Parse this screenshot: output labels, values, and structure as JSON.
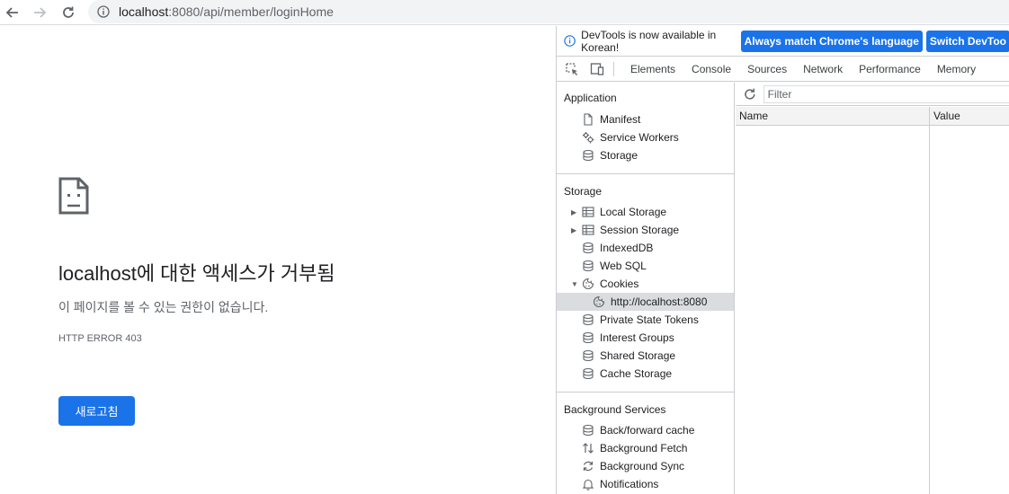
{
  "toolbar": {
    "back_icon": "back-arrow-icon",
    "forward_icon": "forward-arrow-icon",
    "reload_icon": "reload-icon",
    "url_host": "localhost",
    "url_rest": ":8080/api/member/loginHome"
  },
  "error_page": {
    "title": "localhost에 대한 액세스가 거부됨",
    "subtitle": "이 페이지를 볼 수 있는 권한이 없습니다.",
    "error_code": "HTTP ERROR 403",
    "reload_label": "새로고침",
    "accent": "#1a73e8"
  },
  "devtools": {
    "banner": {
      "message": "DevTools is now available in Korean!",
      "match_button": "Always match Chrome's language",
      "switch_button": "Switch DevToo"
    },
    "tabs": [
      "Elements",
      "Console",
      "Sources",
      "Network",
      "Performance",
      "Memory"
    ],
    "sidebar": {
      "application_title": "Application",
      "application_items": [
        {
          "label": "Manifest",
          "icon": "document-icon"
        },
        {
          "label": "Service Workers",
          "icon": "gears-icon"
        },
        {
          "label": "Storage",
          "icon": "database-icon"
        }
      ],
      "storage_title": "Storage",
      "storage_items": [
        {
          "label": "Local Storage",
          "icon": "table-icon",
          "expand": "collapsed"
        },
        {
          "label": "Session Storage",
          "icon": "table-icon",
          "expand": "collapsed"
        },
        {
          "label": "IndexedDB",
          "icon": "database-icon"
        },
        {
          "label": "Web SQL",
          "icon": "database-icon"
        },
        {
          "label": "Cookies",
          "icon": "cookie-icon",
          "expand": "expanded"
        },
        {
          "label": "http://localhost:8080",
          "icon": "cookie-icon",
          "selected": true
        },
        {
          "label": "Private State Tokens",
          "icon": "database-icon"
        },
        {
          "label": "Interest Groups",
          "icon": "database-icon"
        },
        {
          "label": "Shared Storage",
          "icon": "database-icon"
        },
        {
          "label": "Cache Storage",
          "icon": "database-icon"
        }
      ],
      "background_title": "Background Services",
      "background_items": [
        {
          "label": "Back/forward cache",
          "icon": "database-icon"
        },
        {
          "label": "Background Fetch",
          "icon": "updown-arrows-icon"
        },
        {
          "label": "Background Sync",
          "icon": "sync-icon"
        },
        {
          "label": "Notifications",
          "icon": "bell-icon"
        }
      ]
    },
    "main": {
      "filter_placeholder": "Filter",
      "columns": [
        "Name",
        "Value"
      ]
    }
  }
}
